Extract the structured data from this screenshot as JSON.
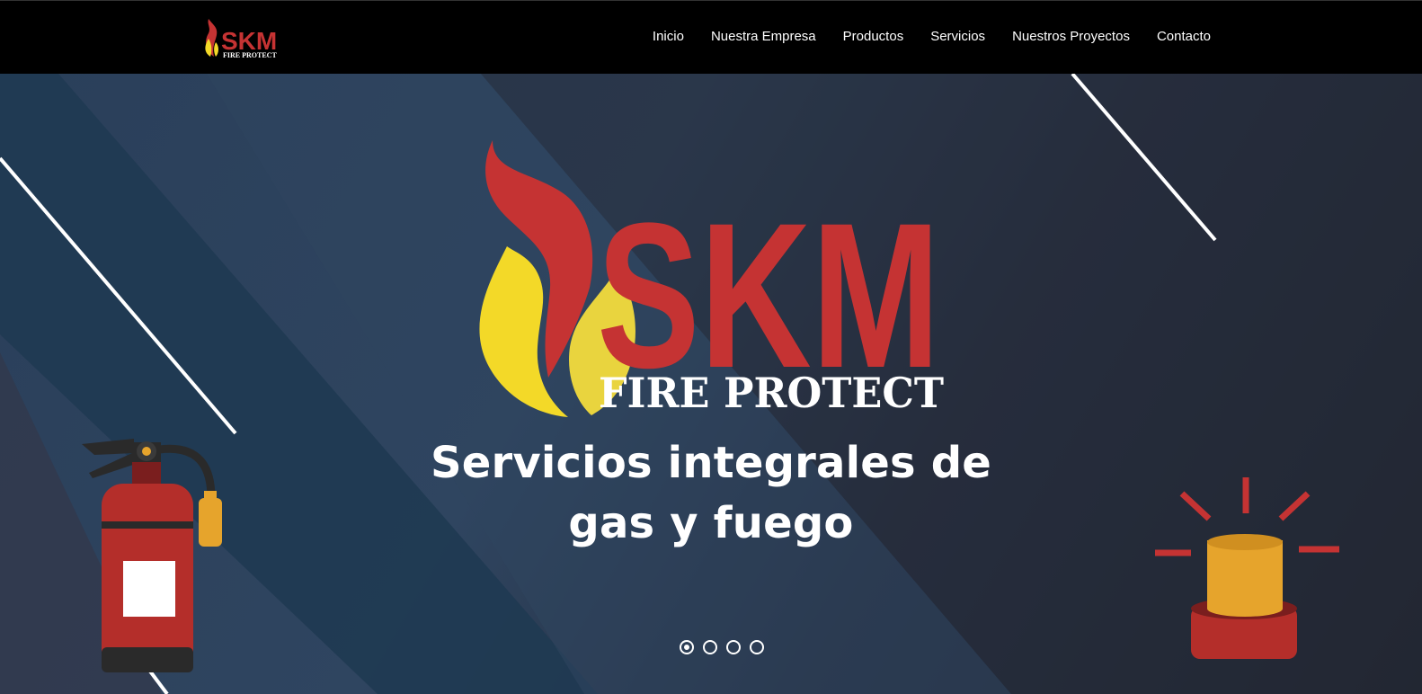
{
  "brand": {
    "logo_text": "SKM",
    "logo_subtext": "FIRE PROTECT"
  },
  "nav": {
    "items": [
      "Inicio",
      "Nuestra Empresa",
      "Productos",
      "Servicios",
      "Nuestros Proyectos",
      "Contacto"
    ]
  },
  "hero": {
    "logo_text": "SKM",
    "logo_subtext": "FIRE PROTECT",
    "headline_line1": "Servicios integrales de",
    "headline_line2": "gas y fuego",
    "slides_total": 4,
    "active_slide": 1
  },
  "colors": {
    "header_bg": "#000000",
    "brand_red": "#c53333",
    "flame_yellow": "#f3d928",
    "hero_blue": "#2d4560",
    "alarm_orange": "#e6a42c"
  },
  "icons": [
    "fire-extinguisher-icon",
    "alarm-beacon-icon",
    "flame-icon"
  ]
}
